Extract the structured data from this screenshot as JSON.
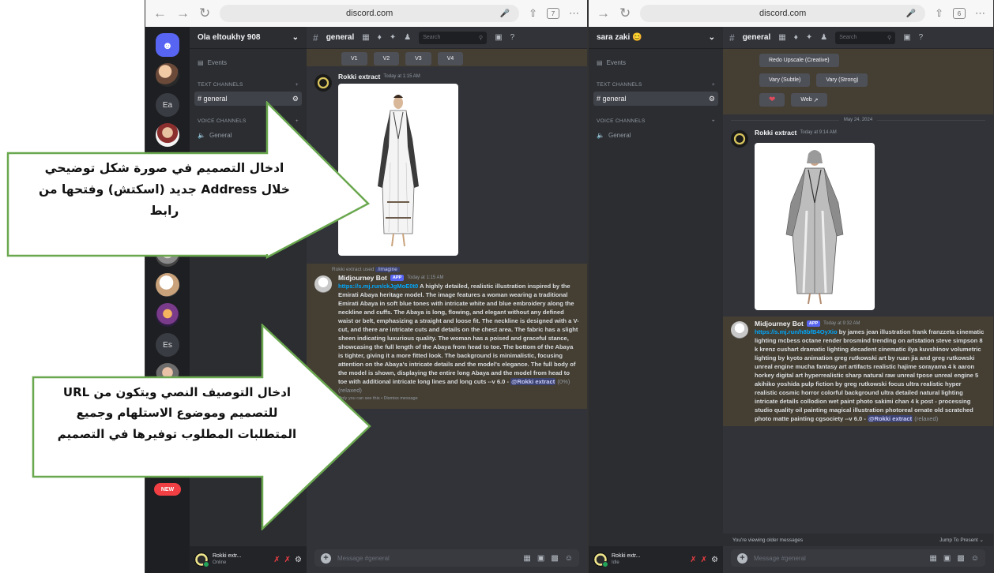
{
  "left": {
    "browser": {
      "url": "discord.com",
      "tab_count": "7"
    },
    "server_initials": {
      "a": "Ea",
      "b": "Es"
    },
    "new_badge": "NEW",
    "guild_name": "Ola eltoukhy 908",
    "events": "Events",
    "text_channels": "TEXT CHANNELS",
    "channel_active": "general",
    "voice_channels": "VOICE CHANNELS",
    "voice_general": "General",
    "channel_title": "general",
    "search_placeholder": "Search",
    "variation_buttons": [
      "V1",
      "V2",
      "V3",
      "V4"
    ],
    "msg1": {
      "author": "Rokki extract",
      "time": "Today at 1:15 AM"
    },
    "reply": {
      "prefix": "Rokki extract used",
      "command": "/imagine"
    },
    "msg2": {
      "author": "Midjourney Bot",
      "tag": "APP",
      "time": "Today at 1:15 AM",
      "link": "https://s.mj.run/ckJgMoE0t0",
      "body": "A highly detailed, realistic illustration inspired by the Emirati Abaya heritage model. The image features a woman wearing a traditional Emirati Abaya in soft blue tones with intricate white and blue embroidery along the neckline and cuffs. The Abaya is long, flowing, and elegant without any defined waist or belt, emphasizing a straight and loose fit. The neckline is designed with a V-cut, and there are intricate cuts and details on the chest area. The fabric has a slight sheen indicating luxurious quality. The woman has a poised and graceful stance, showcasing the full length of the Abaya from head to toe. The bottom of the Abaya is tighter, giving it a more fitted look. The background is minimalistic, focusing attention on the Abaya's intricate details and the model's elegance. The full body of the model is shown, displaying the entire long Abaya and the model from head to toe with additional intricate long lines and long cuts --v 6.0 -",
      "mention": "@Rokki extract",
      "suffix": "(0%) (relaxed)",
      "only_you": "Only you can see this • Dismiss message"
    },
    "composer_placeholder": "Message #general",
    "user": {
      "name": "Rokki extr...",
      "status": "Online"
    }
  },
  "right": {
    "browser": {
      "url": "discord.com",
      "tab_count": "6"
    },
    "guild_name": "sara zaki",
    "events": "Events",
    "text_channels": "TEXT CHANNELS",
    "channel_active": "general",
    "voice_channels": "VOICE CHANNELS",
    "voice_general": "General",
    "channel_title": "general",
    "search_placeholder": "Search",
    "top_button": "Redo Upscale (Creative)",
    "vary_subtle": "Vary (Subtle)",
    "vary_strong": "Vary (Strong)",
    "web_button": "Web",
    "date_divider": "May 24, 2024",
    "msg1": {
      "author": "Rokki extract",
      "time": "Today at 9:14 AM"
    },
    "msg2": {
      "author": "Midjourney Bot",
      "tag": "APP",
      "time": "Today at 9:32 AM",
      "link": "https://s.mj.run/h8bfB4OyXio",
      "body": "by james jean illustration frank franzzeta cinematic lighting mcbess octane render brosmind trending on artstation steve simpson 8 k krenz cushart dramatic lighting decadent cinematic ilya kuvshinov volumetric lighting by kyoto animation greg rutkowski art by ruan jia and greg rutkowski unreal engine mucha fantasy art artifacts realistic hajime sorayama 4 k aaron horkey digital art hyperrealistic sharp natural raw unreal tpose unreal engine 5 akihiko yoshida pulp fiction by greg rutkowski focus ultra realistic hyper realistic cosmic horror colorful background ultra detailed natural lighting intricate details collodion wet paint photo sakimi chan 4 k post - processing studio quality oil painting magical illustration photoreal ornate old scratched photo matte painting cgsociety --v 6.0 -",
      "mention": "@Rokki extract",
      "suffix": "(relaxed)"
    },
    "older_messages": "You're viewing older messages",
    "jump_present": "Jump To Present",
    "composer_placeholder": "Message #general",
    "user": {
      "name": "Rokki extr...",
      "status": "Idle"
    }
  },
  "callouts": {
    "top": {
      "line1": "ادخال التصميم في صورة شكل توضيحي",
      "line2": "خلال Address جديد (اسكتش) وفتحها من",
      "line3": "رابط"
    },
    "bottom": {
      "line1": "ادخال التوصيف النصي ويتكون من URL",
      "line2": "للتصميم وموضوع الاستلهام وجميع",
      "line3": "المتطلبات المطلوب توفيرها في التصميم"
    }
  },
  "colors": {
    "callout_border": "#6aa84f",
    "discord_bg": "#313338",
    "sidebar_bg": "#2b2d31",
    "rail_bg": "#1e1f22",
    "blurple": "#5865f2"
  }
}
